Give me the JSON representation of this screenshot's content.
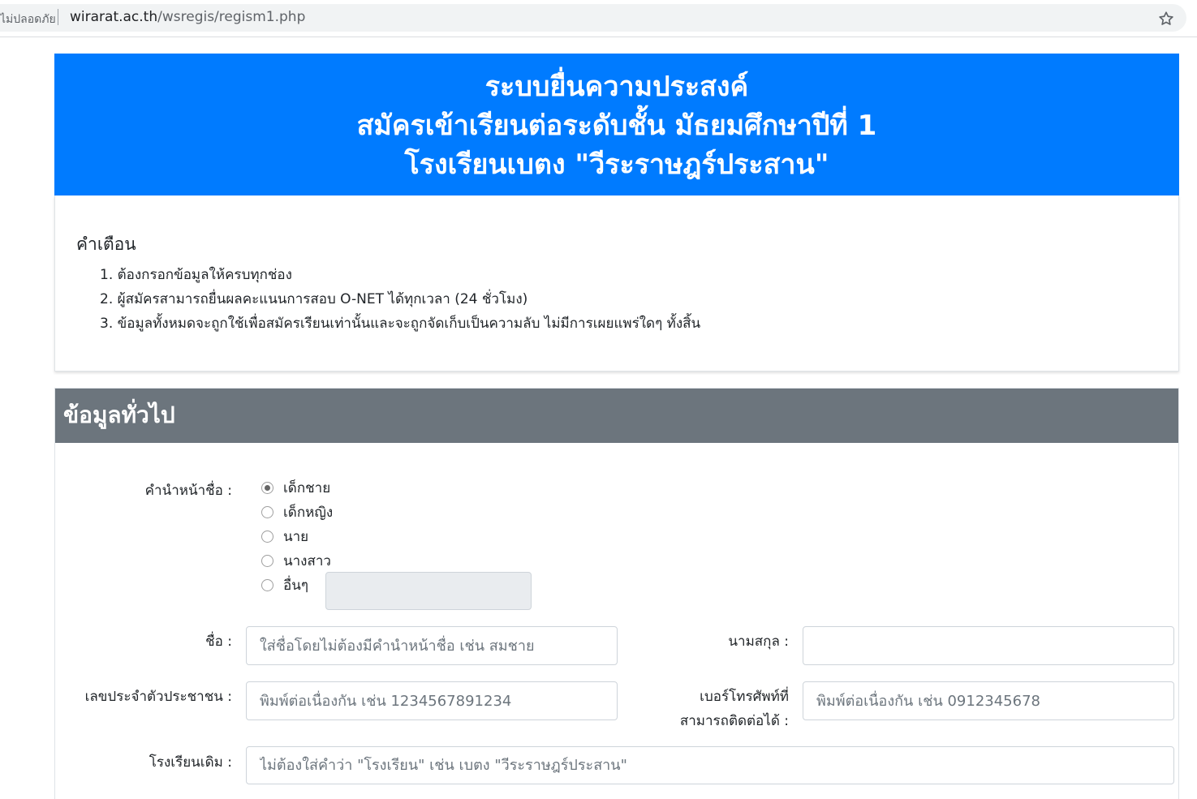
{
  "browser": {
    "security_text": "ไม่ปลอดภัย",
    "url_host": "wirarat.ac.th",
    "url_path": "/wsregis/regism1.php",
    "star_icon": "star-outline-icon"
  },
  "header": {
    "line1": "ระบบยื่นความประสงค์",
    "line2": "สมัครเข้าเรียนต่อระดับชั้น มัธยมศึกษาปีที่ 1",
    "line3": "โรงเรียนเบตง \"วีระราษฎร์ประสาน\"",
    "bg_color": "#007bff"
  },
  "warning": {
    "title": "คำเตือน",
    "items": [
      "1. ต้องกรอกข้อมูลให้ครบทุกช่อง",
      "2. ผู้สมัครสามารถยื่นผลคะแนนการสอบ O-NET ได้ทุกเวลา (24 ชั่วโมง)",
      "3. ข้อมูลทั้งหมดจะถูกใช้เพื่อสมัครเรียนเท่านั้นและจะถูกจัดเก็บเป็นความลับ ไม่มีการเผยแพร่ใดๆ ทั้งสิ้น"
    ]
  },
  "general": {
    "title": "ข้อมูลทั่วไป",
    "header_color": "#6c757d",
    "prefix_label": "คำนำหน้าชื่อ :",
    "prefix_options": [
      "เด็กชาย",
      "เด็กหญิง",
      "นาย",
      "นางสาว",
      "อื่นๆ"
    ],
    "prefix_selected": "เด็กชาย",
    "other_value": "",
    "first_name_label": "ชื่อ :",
    "first_name_placeholder": "ใส่ชื่อโดยไม่ต้องมีคำนำหน้าชื่อ เช่น สมชาย",
    "last_name_label": "นามสกุล :",
    "last_name_value": "",
    "id_label": "เลขประจำตัวประชาชน :",
    "id_placeholder": "พิมพ์ต่อเนื่องกัน เช่น 1234567891234",
    "phone_label_line1": "เบอร์โทรศัพท์ที่",
    "phone_label_line2": "สามารถติดต่อได้ :",
    "phone_placeholder": "พิมพ์ต่อเนื่องกัน เช่น 0912345678",
    "school_label": "โรงเรียนเดิม :",
    "school_placeholder": "ไม่ต้องใส่คำว่า \"โรงเรียน\" เช่น เบตง \"วีระราษฎร์ประสาน\""
  }
}
